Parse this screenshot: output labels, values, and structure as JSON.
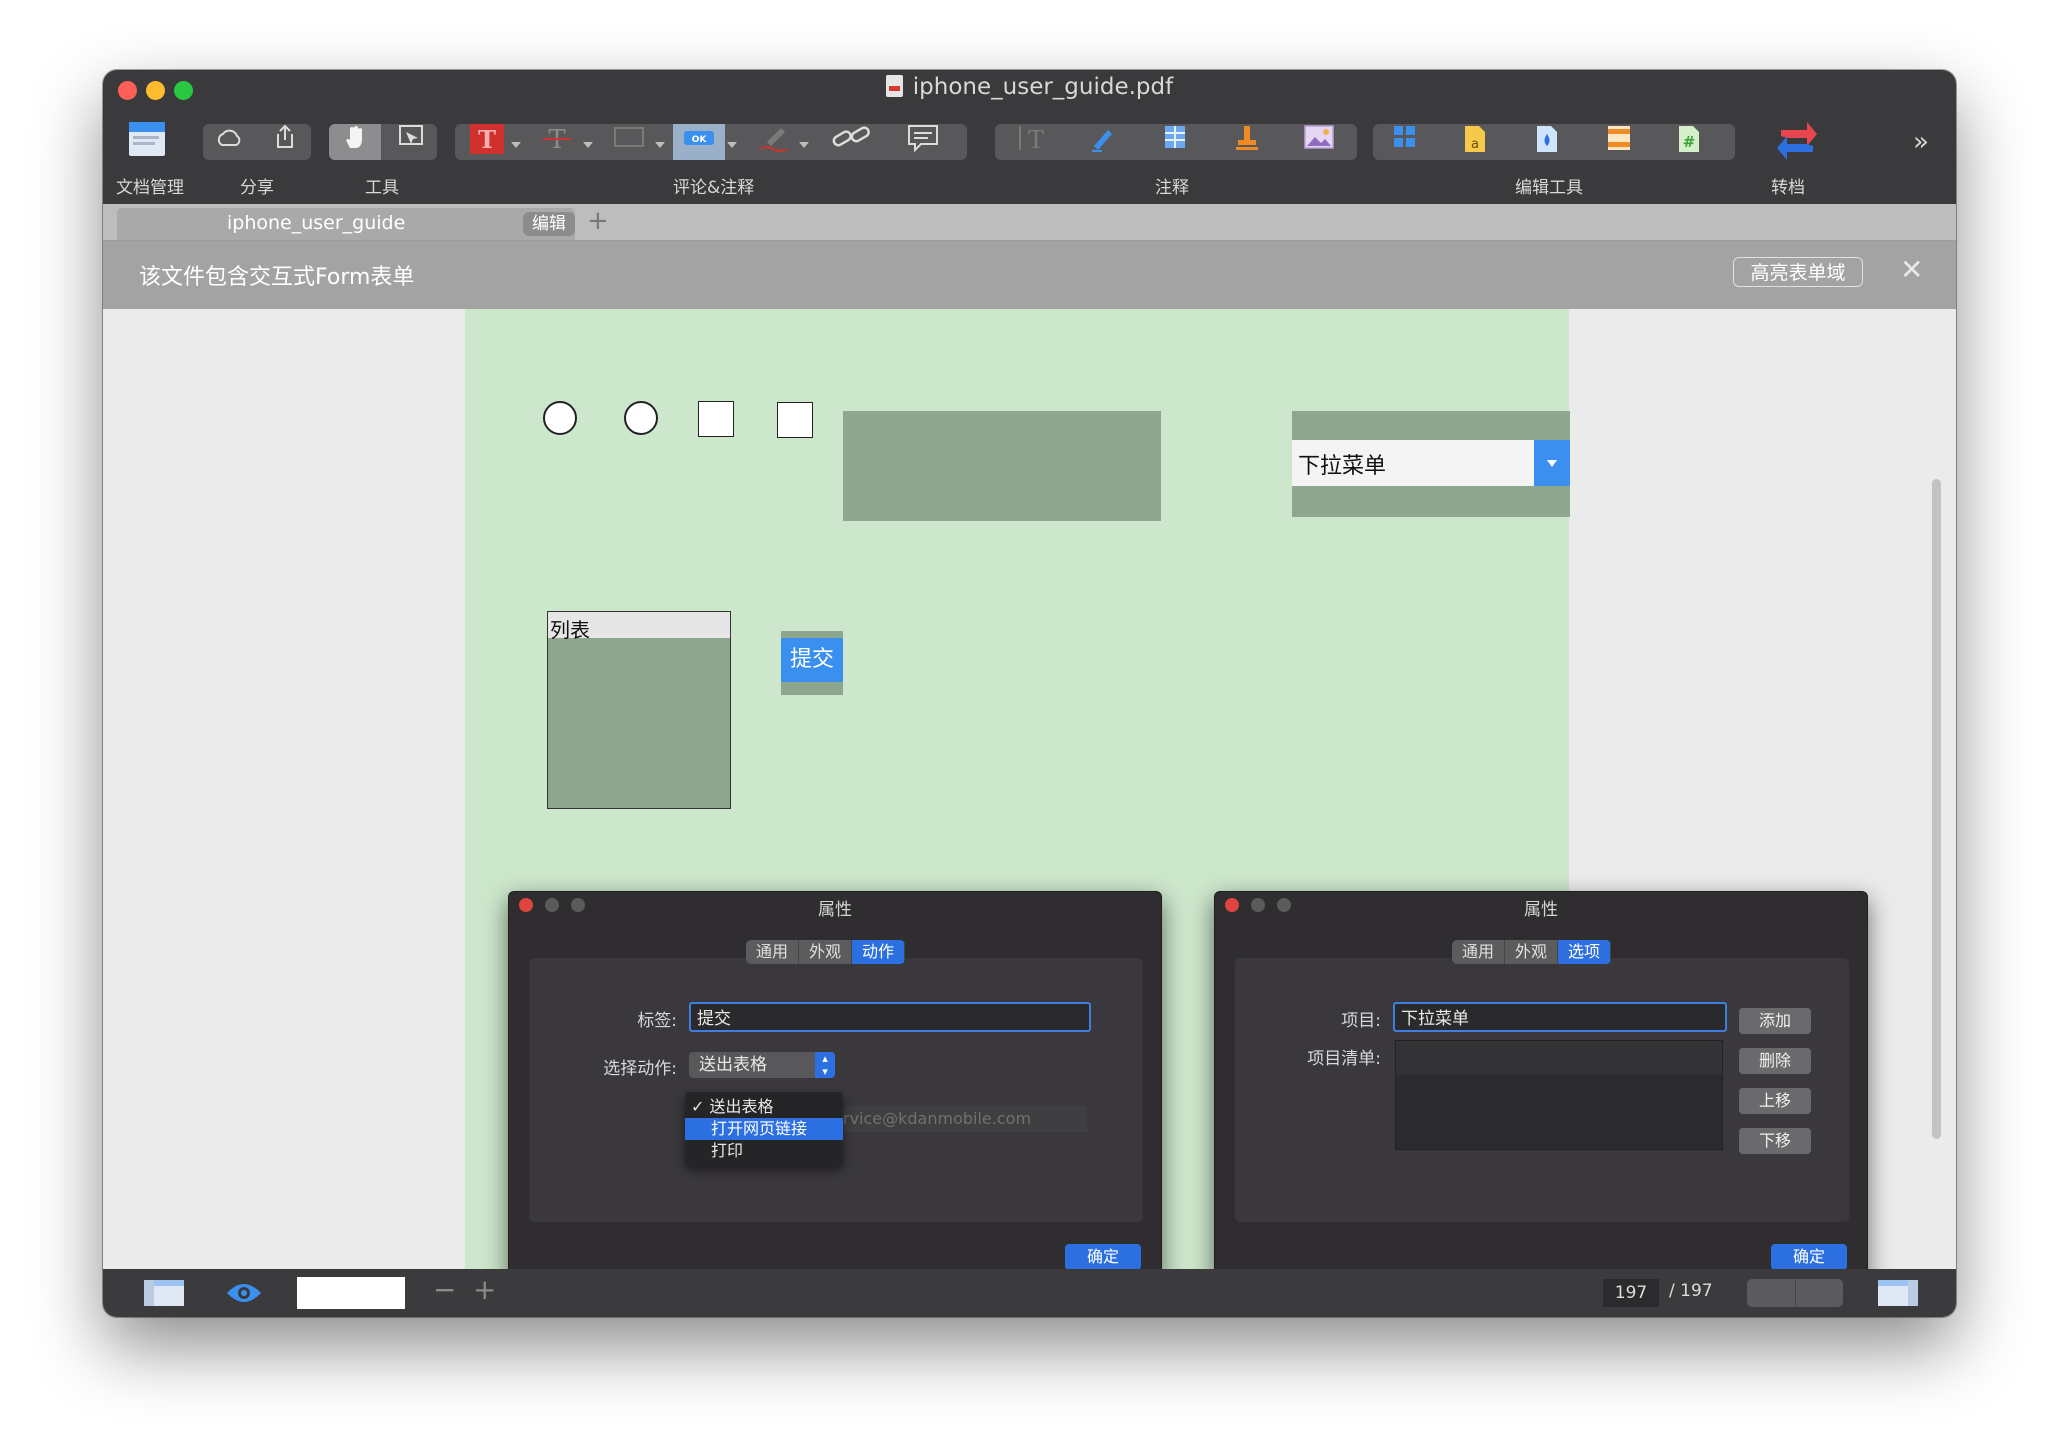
{
  "window": {
    "title": "iphone_user_guide.pdf"
  },
  "toolbar": {
    "groups": [
      {
        "label": "文档管理"
      },
      {
        "label": "分享"
      },
      {
        "label": "工具"
      },
      {
        "label": "评论&注释"
      },
      {
        "label": "注释"
      },
      {
        "label": "编辑工具"
      },
      {
        "label": "转档"
      }
    ],
    "overflow": "»"
  },
  "tabs": {
    "doc_tab": "iphone_user_guide",
    "mode_badge": "编辑",
    "add": "+"
  },
  "banner": {
    "message": "该文件包含交互式Form表单",
    "highlight_button": "高亮表单域",
    "close": "✕"
  },
  "form": {
    "dropdown_value": "下拉菜单",
    "list_label": "列表",
    "submit_label": "提交"
  },
  "dialog_button": {
    "title": "属性",
    "tabs": [
      "通用",
      "外观",
      "动作"
    ],
    "active_tab": "动作",
    "label_caption": "标签:",
    "label_value": "提交",
    "action_caption": "选择动作:",
    "action_value": "送出表格",
    "menu_items": [
      "✓ 送出表格",
      "打开网页链接",
      "打印"
    ],
    "selected_menu_item": "打开网页链接",
    "email_partial": "rvice@kdanmobile.com",
    "ok": "确定"
  },
  "dialog_options": {
    "title": "属性",
    "tabs": [
      "通用",
      "外观",
      "选项"
    ],
    "active_tab": "选项",
    "item_caption": "项目:",
    "item_value": "下拉菜单",
    "list_caption": "项目清单:",
    "buttons": [
      "添加",
      "删除",
      "上移",
      "下移"
    ],
    "ok": "确定"
  },
  "statusbar": {
    "current_page": "197",
    "total_pages": "/ 197",
    "zoom_minus": "−",
    "zoom_plus": "+"
  },
  "colors": {
    "page_background": "#cde7cc",
    "form_field": "#8fa68e",
    "accent": "#2c6fe0",
    "dark_chrome": "#3a393b"
  }
}
